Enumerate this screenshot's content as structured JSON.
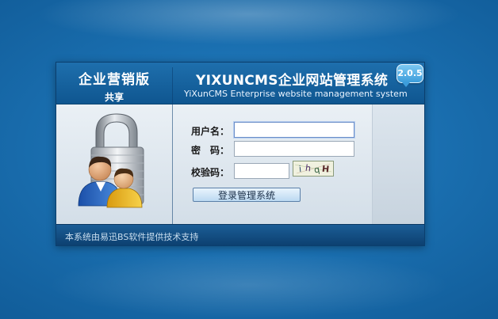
{
  "header": {
    "edition_name": "企业营销版",
    "edition_sub": "共享",
    "title_cn": "YIXUNCMS企业网站管理系统",
    "title_en": "YiXunCMS Enterprise website management system",
    "version": "2.0.5"
  },
  "form": {
    "username_label": "用户名：",
    "username_value": "",
    "password_label": "密　码：",
    "password_value": "",
    "captcha_label": "校验码：",
    "captcha_value": "",
    "captcha_text": "ihqH",
    "login_label": "登录管理系统"
  },
  "footer": {
    "text": "本系统由易迅BS软件提供技术支持"
  },
  "colors": {
    "background": "#1a6fb0",
    "header": "#135f9c",
    "footer": "#0f4a80",
    "button": "#cfe6f8"
  },
  "icons": [
    "lock-icon",
    "users-icon"
  ]
}
